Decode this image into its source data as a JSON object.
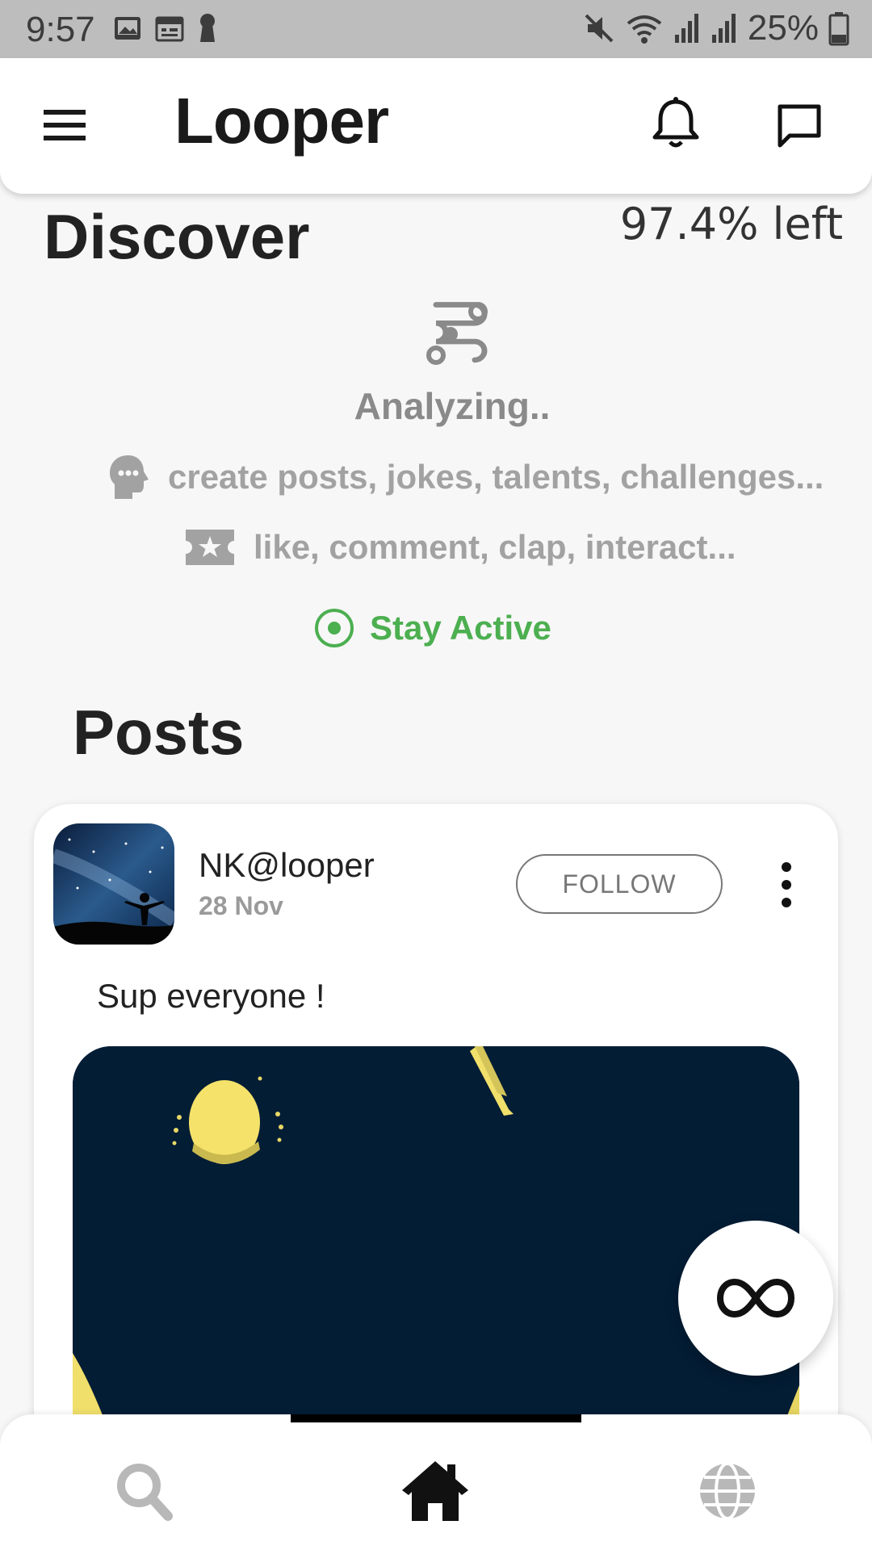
{
  "status_bar": {
    "time": "9:57",
    "battery_text": "25%",
    "left_icons": [
      "image-icon",
      "calendar-icon",
      "keyhole-icon"
    ],
    "right_icons": [
      "mute-icon",
      "wifi-icon",
      "signal-icon",
      "signal-icon",
      "battery-icon"
    ]
  },
  "app_bar": {
    "brand": "Looper",
    "icons": [
      "menu-icon",
      "bell-icon",
      "chat-icon"
    ]
  },
  "discover": {
    "title": "Discover",
    "remaining": "97.4% left",
    "status": "Analyzing..",
    "tip_create": "create posts, jokes, talents, challenges...",
    "tip_interact": "like, comment, clap, interact...",
    "stay_active": "Stay Active",
    "accent_color": "#4caf50"
  },
  "posts": {
    "title": "Posts",
    "items": [
      {
        "user": "NK@looper",
        "date": "28 Nov",
        "follow_label": "FOLLOW",
        "text": "Sup everyone !"
      }
    ]
  },
  "bottom_nav": {
    "items": [
      "search-icon",
      "home-icon",
      "globe-icon"
    ],
    "active": "home-icon"
  }
}
